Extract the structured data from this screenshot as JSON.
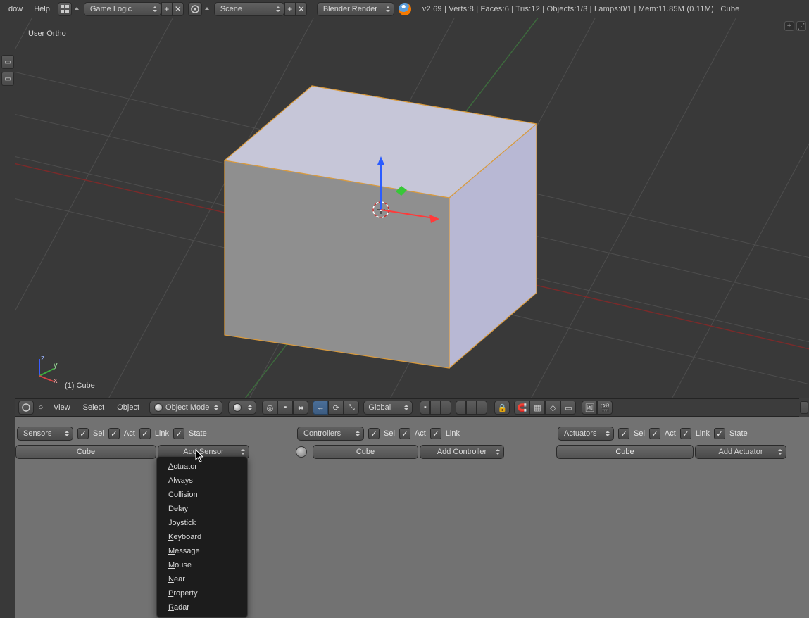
{
  "header": {
    "menu_window": "dow",
    "menu_help": "Help",
    "screen_layout": "Game Logic",
    "scene": "Scene",
    "render_engine": "Blender Render",
    "stats": "v2.69 | Verts:8 | Faces:6 | Tris:12 | Objects:1/3 | Lamps:0/1 | Mem:11.85M (0.11M) | Cube"
  },
  "viewport": {
    "view_label": "User Ortho",
    "object_label": "(1)  Cube"
  },
  "v3d_header": {
    "menu_view": "View",
    "menu_select": "Select",
    "menu_object": "Object",
    "mode": "Object Mode",
    "orientation": "Global"
  },
  "logic": {
    "sensors": {
      "title": "Sensors",
      "sel": "Sel",
      "act": "Act",
      "link": "Link",
      "state": "State",
      "object": "Cube",
      "add_label": "Add Sensor",
      "menu": [
        "Actuator",
        "Always",
        "Collision",
        "Delay",
        "Joystick",
        "Keyboard",
        "Message",
        "Mouse",
        "Near",
        "Property",
        "Radar"
      ]
    },
    "controllers": {
      "title": "Controllers",
      "sel": "Sel",
      "act": "Act",
      "link": "Link",
      "object": "Cube",
      "add_label": "Add Controller"
    },
    "actuators": {
      "title": "Actuators",
      "sel": "Sel",
      "act": "Act",
      "link": "Link",
      "state": "State",
      "object": "Cube",
      "add_label": "Add Actuator"
    }
  }
}
